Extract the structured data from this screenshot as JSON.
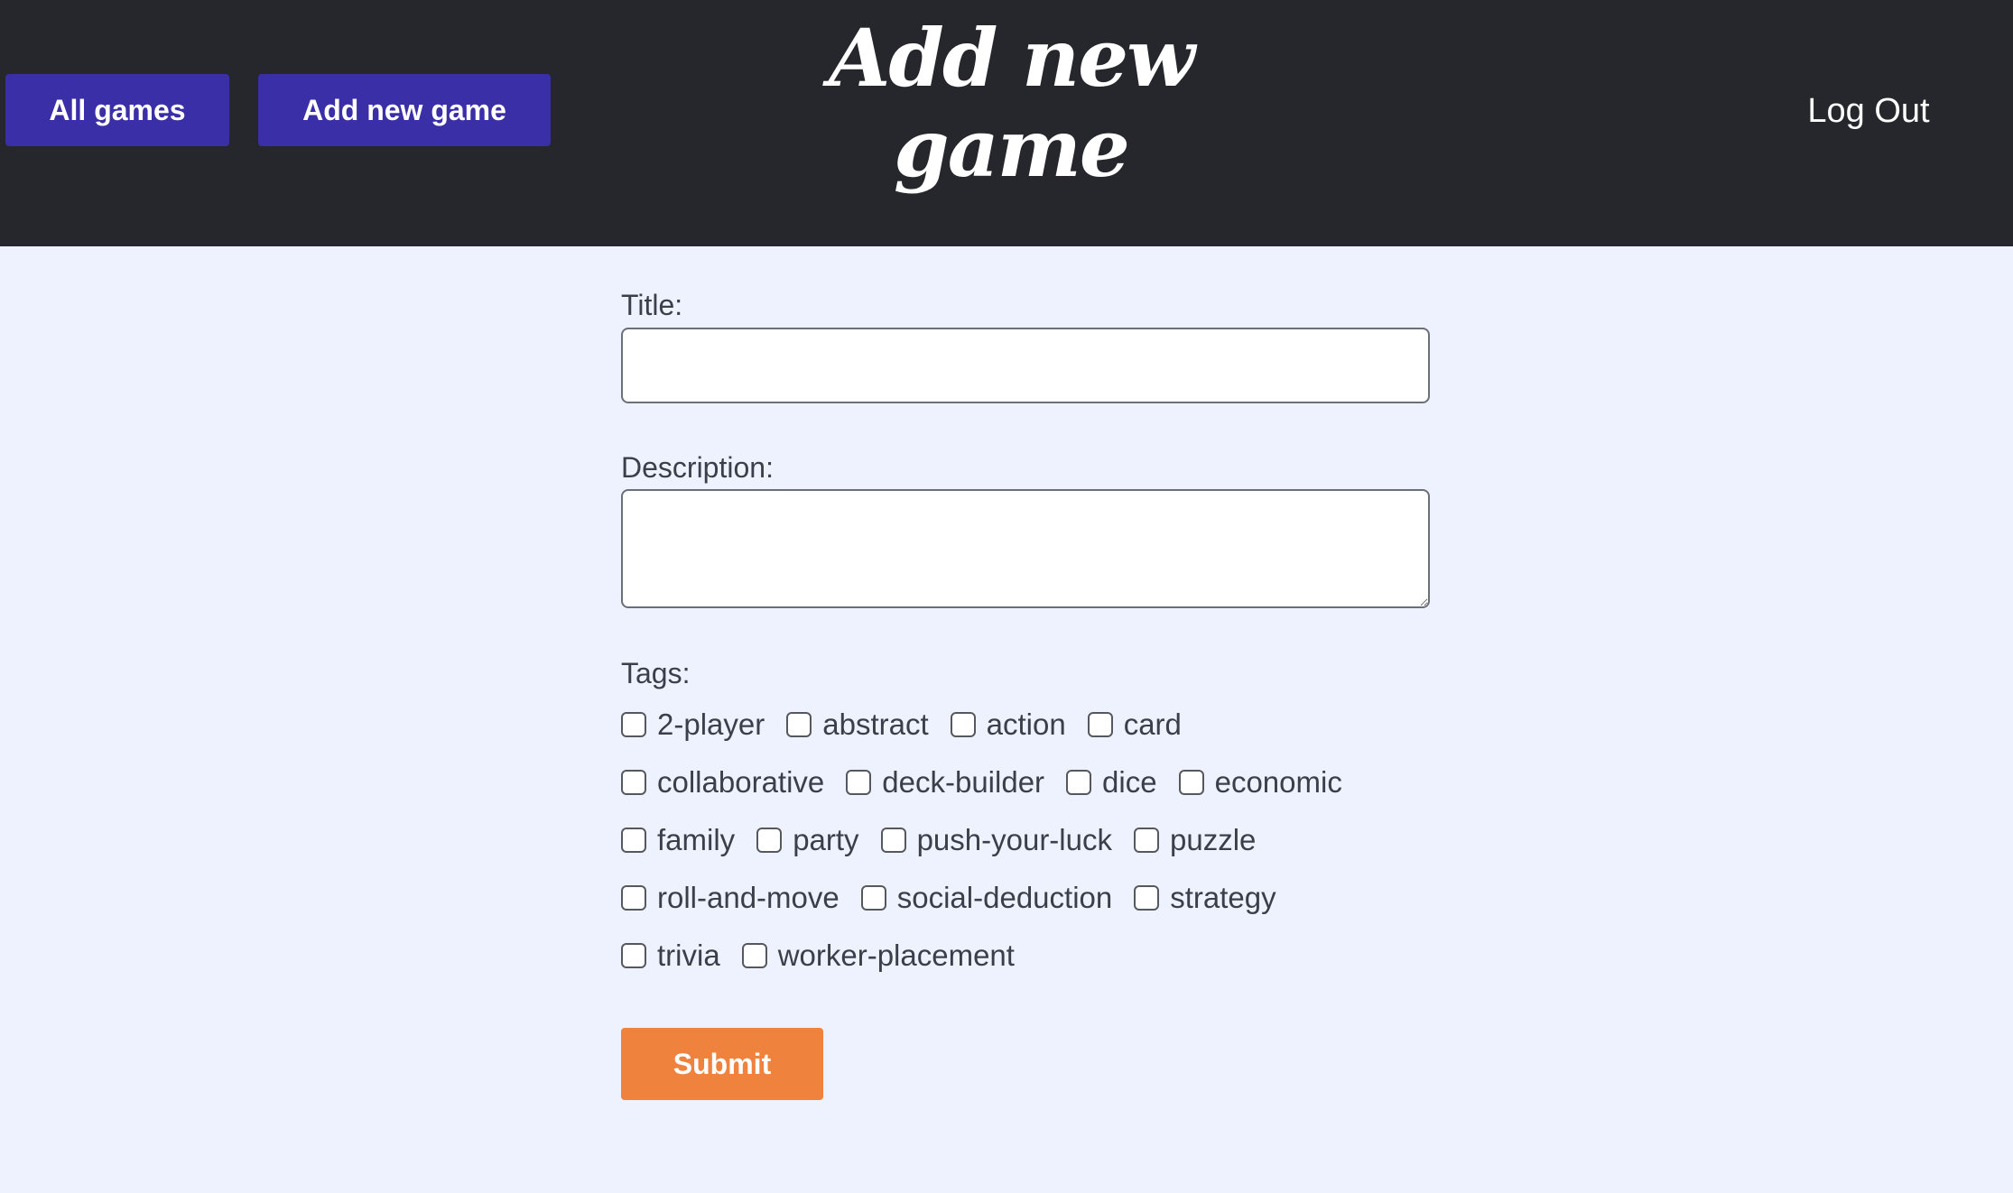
{
  "header": {
    "nav": {
      "all_games": "All games",
      "add_new_game": "Add new game"
    },
    "title": "Add new game",
    "logout": "Log Out"
  },
  "form": {
    "title_label": "Title:",
    "title_value": "",
    "description_label": "Description:",
    "description_value": "",
    "tags_label": "Tags:",
    "tag_rows": [
      [
        "2-player",
        "abstract",
        "action",
        "card"
      ],
      [
        "collaborative",
        "deck-builder",
        "dice",
        "economic"
      ],
      [
        "family",
        "party",
        "push-your-luck",
        "puzzle"
      ],
      [
        "roll-and-move",
        "social-deduction",
        "strategy"
      ],
      [
        "trivia",
        "worker-placement"
      ]
    ],
    "submit_label": "Submit"
  },
  "colors": {
    "header_bg": "#26272d",
    "page_bg": "#eef2fe",
    "nav_button": "#3a2fa6",
    "submit_button": "#ef833e"
  }
}
